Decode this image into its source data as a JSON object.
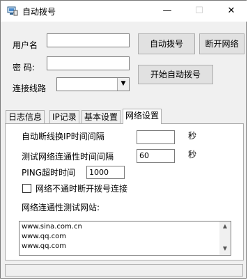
{
  "window": {
    "title": "自动拨号",
    "minimize_glyph": "—",
    "maximize_glyph": "☐",
    "close_glyph": "✕"
  },
  "login": {
    "username_label": "用户名",
    "username_value": "",
    "password_label": "密  码:",
    "password_value": "",
    "line_label": "连接线路",
    "line_value": ""
  },
  "buttons": {
    "auto_dial": "自动拨号",
    "disconnect": "断开网络",
    "start_auto_dial": "开始自动拨号"
  },
  "tabs": [
    {
      "label": "日志信息",
      "active": false
    },
    {
      "label": "IP记录",
      "active": false
    },
    {
      "label": "基本设置",
      "active": false
    },
    {
      "label": "网络设置",
      "active": true
    }
  ],
  "network_settings": {
    "disconnect_label": "自动断线换IP时间间隔",
    "disconnect_value": "",
    "disconnect_unit": "秒",
    "test_interval_label": "测试网络连通性时间间隔",
    "test_interval_value": "60",
    "test_interval_unit": "秒",
    "ping_timeout_label": "PING超时时间",
    "ping_timeout_value": "1000",
    "stop_on_fail_label": "网络不通时断开拨号连接",
    "stop_on_fail_checked": false,
    "test_sites_label": "网络连通性测试网站:",
    "test_sites": [
      "www.sina.com.cn",
      "www.qq.com",
      "www.qq.com"
    ]
  }
}
